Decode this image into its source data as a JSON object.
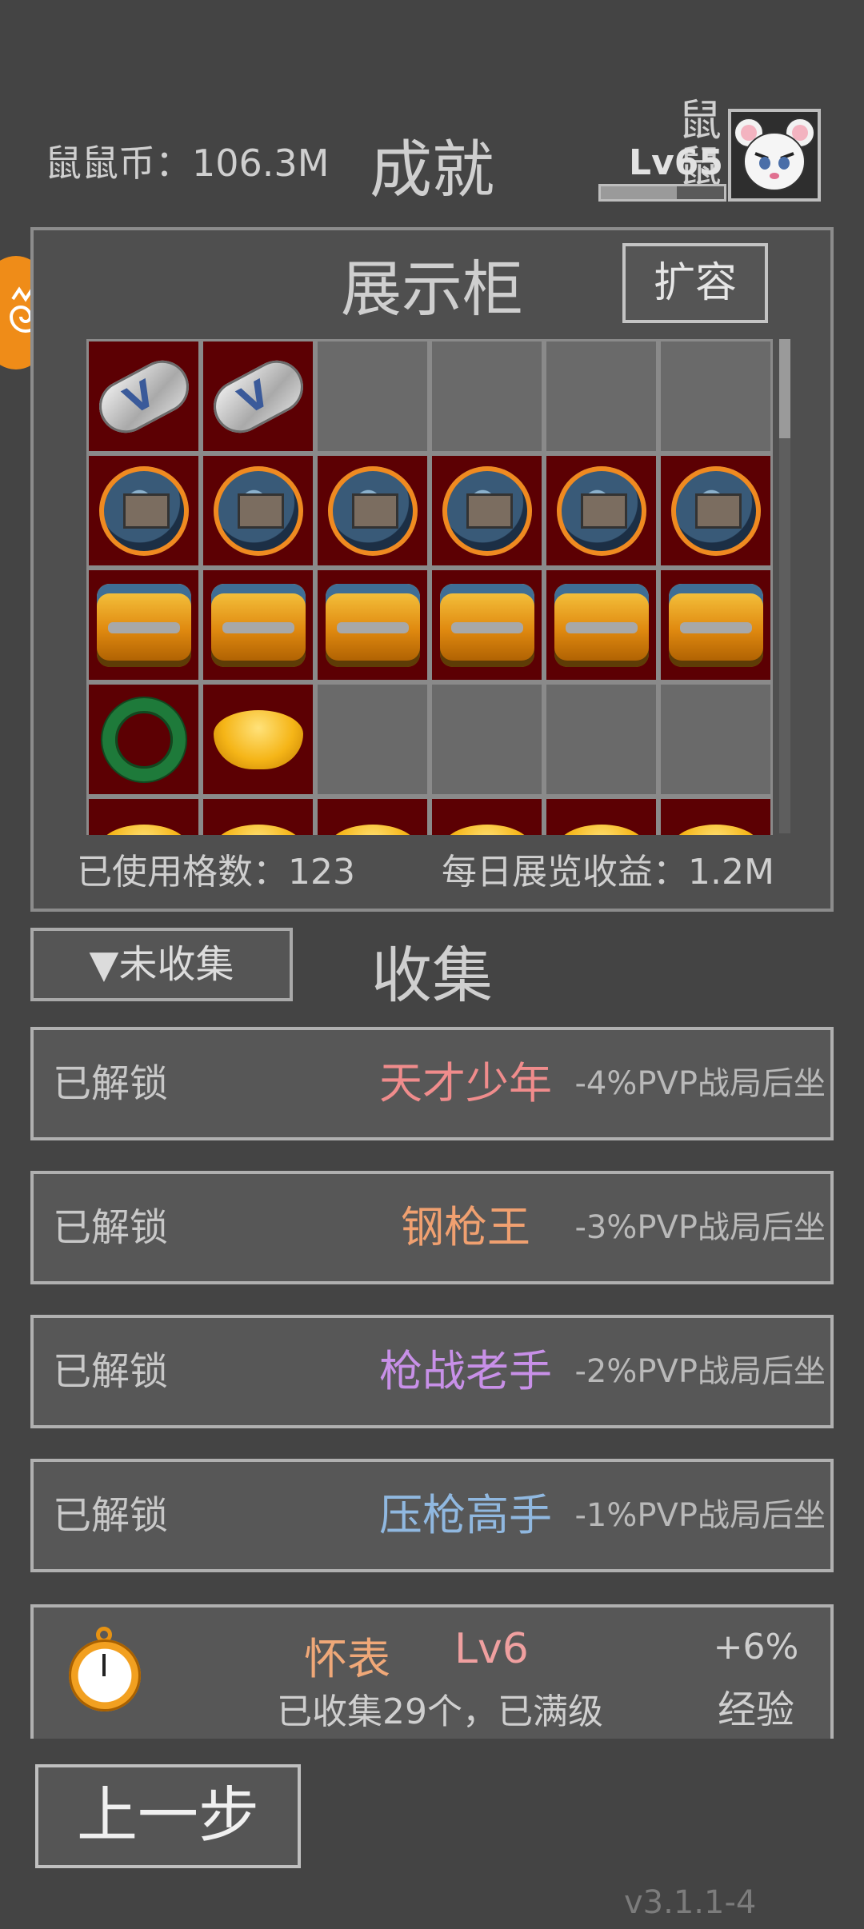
{
  "header": {
    "coins_text": "鼠鼠币：106.3M",
    "page_title": "成就",
    "player_name": "鼠鼠",
    "player_level": "Lv65",
    "xp_fraction": 0.62
  },
  "cabinet": {
    "title": "展示柜",
    "expand_label": "扩容",
    "used_slots_text": "已使用格数：123",
    "daily_income_text": "每日展览收益：1.2M",
    "rows": [
      [
        "capsule",
        "capsule",
        "empty",
        "empty",
        "empty",
        "empty"
      ],
      [
        "watch",
        "watch",
        "watch",
        "watch",
        "watch",
        "watch"
      ],
      [
        "jar",
        "jar",
        "jar",
        "jar",
        "jar",
        "jar"
      ],
      [
        "ring",
        "ingot",
        "empty",
        "empty",
        "empty",
        "empty"
      ],
      [
        "ingot",
        "ingot",
        "ingot",
        "ingot",
        "ingot",
        "ingot"
      ]
    ]
  },
  "collection": {
    "filter_label": "▼未收集",
    "title": "收集",
    "achievements": [
      {
        "status": "已解锁",
        "name": "天才少年",
        "color": "#f08c8c",
        "bonus": "-4%PVP战局后坐"
      },
      {
        "status": "已解锁",
        "name": "钢枪王",
        "color": "#f0a070",
        "bonus": "-3%PVP战局后坐"
      },
      {
        "status": "已解锁",
        "name": "枪战老手",
        "color": "#c890e8",
        "bonus": "-2%PVP战局后坐"
      },
      {
        "status": "已解锁",
        "name": "压枪高手",
        "color": "#90b8e0",
        "bonus": "-1%PVP战局后坐"
      }
    ],
    "item": {
      "icon": "pocket-watch-icon",
      "name": "怀表",
      "level": "Lv6",
      "progress": "已收集29个，已满级",
      "bonus": "+6%",
      "bonus_type": "经验"
    }
  },
  "footer": {
    "back_label": "上一步",
    "version": "v3.1.1-4"
  }
}
